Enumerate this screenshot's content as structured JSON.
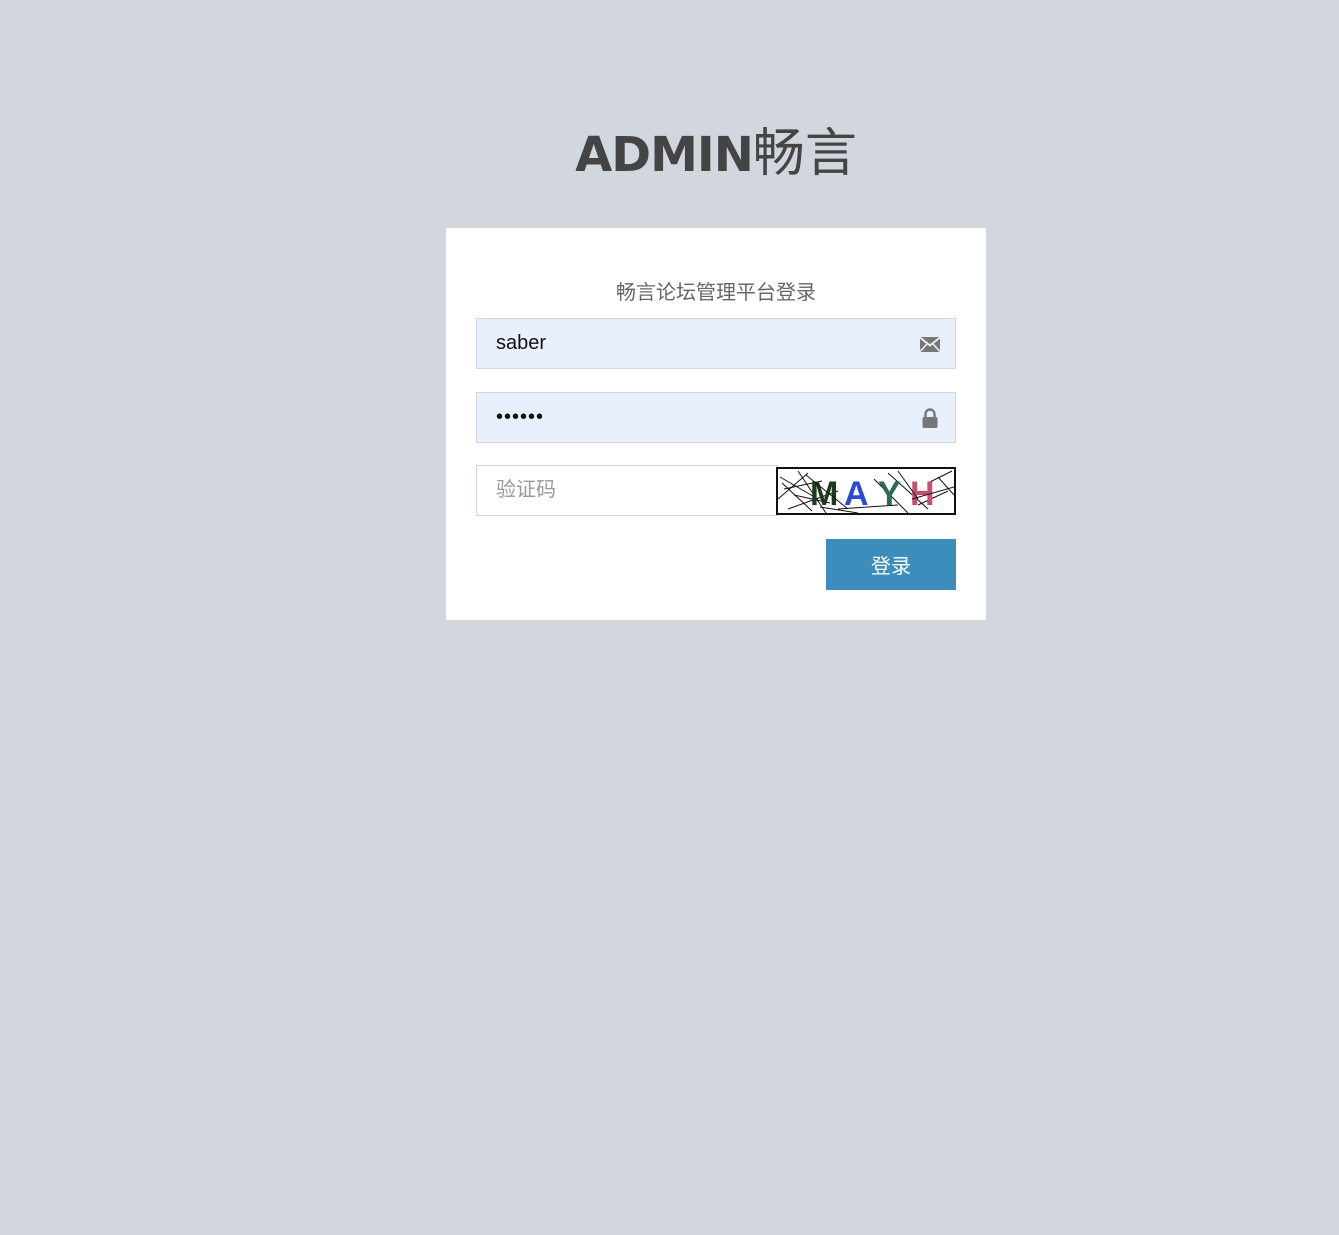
{
  "logo": {
    "bold": "ADMIN",
    "light": "畅言"
  },
  "login": {
    "message": "畅言论坛管理平台登录",
    "email": {
      "value": "saber",
      "icon": "envelope-icon"
    },
    "password": {
      "value": "••••••",
      "icon": "lock-icon"
    },
    "captcha": {
      "placeholder": "验证码",
      "value": "",
      "image_text": [
        "M",
        "A",
        "Y",
        "H"
      ],
      "image_text_colors": [
        "#1e3a1e",
        "#2a4bd6",
        "#2e6b4f",
        "#c8506e"
      ]
    },
    "submit_label": "登录"
  },
  "colors": {
    "background": "#d2d6de",
    "button": "#3c8dbc",
    "autofill": "#e8f0fe"
  }
}
